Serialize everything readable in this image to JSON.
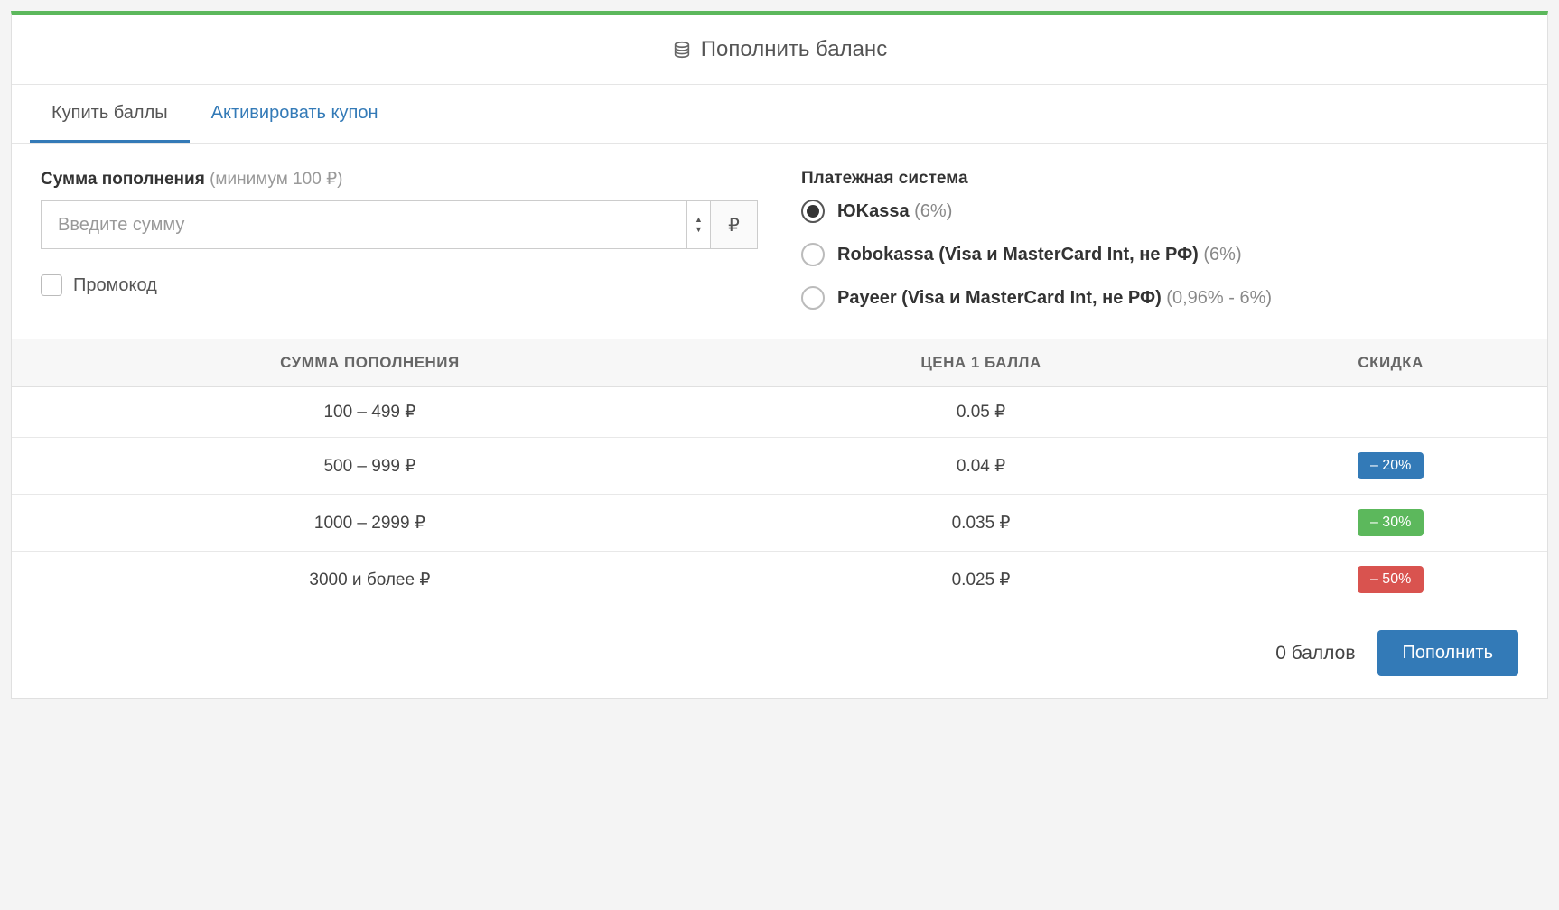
{
  "header": {
    "title": "Пополнить баланс"
  },
  "tabs": {
    "buy": "Купить баллы",
    "coupon": "Активировать купон"
  },
  "form": {
    "amount_label": "Сумма пополнения",
    "amount_hint": "(минимум 100 ₽)",
    "amount_placeholder": "Введите сумму",
    "currency": "₽",
    "promo_label": "Промокод",
    "payment_label": "Платежная система",
    "payment_options": [
      {
        "name": "ЮKassa",
        "fee": "(6%)",
        "selected": true
      },
      {
        "name": "Robokassa (Visa и MasterCard Int, не РФ)",
        "fee": "(6%)",
        "selected": false
      },
      {
        "name": "Payeer (Visa и MasterCard Int, не РФ)",
        "fee": "(0,96% - 6%)",
        "selected": false
      }
    ]
  },
  "table": {
    "headers": {
      "amount": "СУММА ПОПОЛНЕНИЯ",
      "price": "ЦЕНА 1 БАЛЛА",
      "discount": "СКИДКА"
    },
    "rows": [
      {
        "amount": "100 – 499 ₽",
        "price": "0.05 ₽",
        "discount": "",
        "badge_class": ""
      },
      {
        "amount": "500 – 999 ₽",
        "price": "0.04 ₽",
        "discount": "– 20%",
        "badge_class": "badge-blue"
      },
      {
        "amount": "1000 – 2999 ₽",
        "price": "0.035 ₽",
        "discount": "– 30%",
        "badge_class": "badge-green"
      },
      {
        "amount": "3000 и более ₽",
        "price": "0.025 ₽",
        "discount": "– 50%",
        "badge_class": "badge-red"
      }
    ]
  },
  "footer": {
    "points": "0 баллов",
    "submit": "Пополнить"
  }
}
